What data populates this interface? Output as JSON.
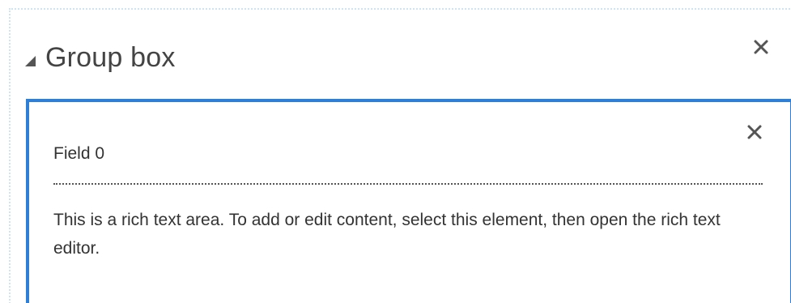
{
  "group_box": {
    "title": "Group box",
    "toggle_icon": "collapse-triangle-icon",
    "close_icon": "close-icon"
  },
  "field": {
    "label": "Field 0",
    "content": "This is a rich text area. To add or edit content, select this element, then open the rich text editor.",
    "close_icon": "close-icon",
    "selected": true
  },
  "colors": {
    "selection_border": "#2f7fd6",
    "outline": "#cfe3f3",
    "text": "#333333"
  }
}
